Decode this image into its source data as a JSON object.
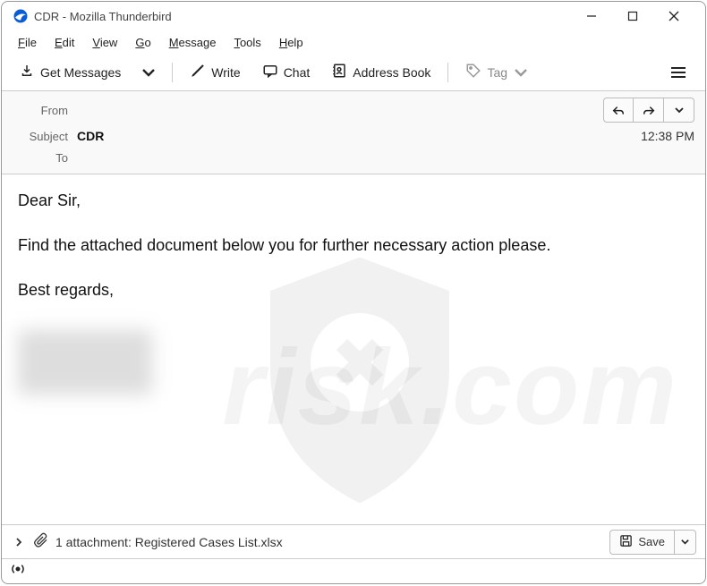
{
  "window": {
    "title": "CDR - Mozilla Thunderbird"
  },
  "menu": {
    "file": "File",
    "edit": "Edit",
    "view": "View",
    "go": "Go",
    "message": "Message",
    "tools": "Tools",
    "help": "Help"
  },
  "toolbar": {
    "get_messages": "Get Messages",
    "write": "Write",
    "chat": "Chat",
    "address_book": "Address Book",
    "tag": "Tag"
  },
  "headers": {
    "from_label": "From",
    "from_value": "",
    "subject_label": "Subject",
    "subject_value": "CDR",
    "to_label": "To",
    "to_value": "",
    "time": "12:38 PM"
  },
  "body": {
    "greeting": "Dear Sir,",
    "line1": "Find the attached document below you for further necessary action please.",
    "signoff": "Best regards,"
  },
  "attachment": {
    "count_label": "1 attachment: ",
    "filename": "Registered Cases List.xlsx",
    "save_label": "Save"
  },
  "watermark": {
    "text": "risk.com"
  }
}
